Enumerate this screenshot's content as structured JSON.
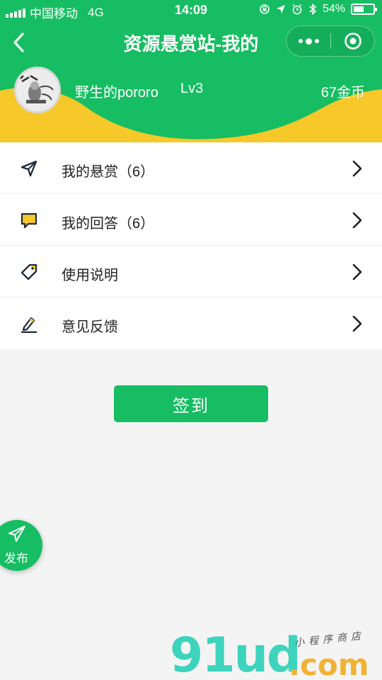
{
  "statusbar": {
    "carrier": "中国移动",
    "network": "4G",
    "time": "14:09",
    "battery": "54%",
    "battery_level": 0.54
  },
  "navbar": {
    "title": "资源悬赏站-我的"
  },
  "profile": {
    "username": "野生的pororo",
    "level": "Lv3",
    "coins": "67金币"
  },
  "menu": [
    {
      "label": "我的悬赏（6）",
      "icon": "send-icon"
    },
    {
      "label": "我的回答（6）",
      "icon": "comment-icon"
    },
    {
      "label": "使用说明",
      "icon": "tag-icon"
    },
    {
      "label": "意见反馈",
      "icon": "edit-icon"
    }
  ],
  "signin": {
    "label": "签到"
  },
  "fab": {
    "label": "发布",
    "icon": "paper-plane-icon"
  },
  "watermark": {
    "logo": "91ud",
    "dot_com": ".com",
    "tagline": "小程序商店"
  },
  "colors": {
    "primary": "#16bd62",
    "accent_yellow": "#f7c82a",
    "page_bg": "#f4f4f4"
  }
}
